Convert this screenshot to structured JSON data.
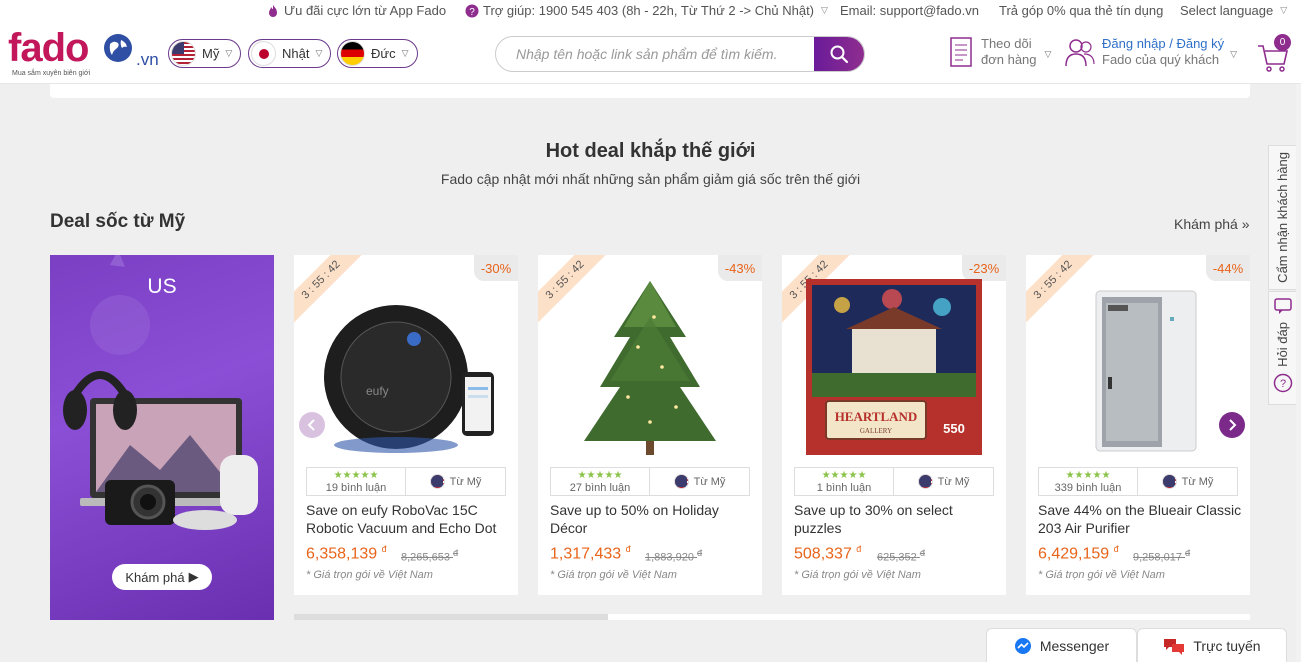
{
  "topbar": {
    "app_promo": "Ưu đãi cực lớn từ App Fado",
    "support": "Trợ giúp: 1900 545 403  (8h - 22h, Từ Thứ 2 -> Chủ Nhật)",
    "email": "Email: support@fado.vn",
    "installment": "Trả góp 0% qua thẻ tín dụng",
    "language": "Select language"
  },
  "header": {
    "logo_text": "fado",
    "logo_tld": ".vn",
    "logo_tagline": "Mua sắm xuyên biên giới",
    "countries": [
      "Mỹ",
      "Nhật",
      "Đức"
    ],
    "search_placeholder": "Nhập tên hoặc link sản phẩm để tìm kiếm.",
    "track_orders": [
      "Theo dõi",
      "đơn hàng"
    ],
    "login_register": "Đăng nhập / Đăng ký",
    "greeting": "Fado của quý khách",
    "cart_count": "0"
  },
  "section": {
    "title": "Hot deal khắp thế giới",
    "subtitle": "Fado cập nhật mới nhất những sản phẩm giảm giá sốc trên thế giới"
  },
  "deal_row": {
    "title": "Deal sốc từ Mỹ",
    "explore": "Khám phá »",
    "banner_label": "US",
    "banner_button": "Khám phá"
  },
  "products": [
    {
      "timer": "3 : 55 : 42",
      "discount": "-30%",
      "reviews": "19 bình luận",
      "origin": "Từ Mỹ",
      "name": "Save on eufy RoboVac 15C Robotic Vacuum and Echo Dot",
      "price": "6,358,139",
      "old_price": "8,265,653",
      "note": "* Giá trọn gói về Việt Nam"
    },
    {
      "timer": "3 : 55 : 42",
      "discount": "-43%",
      "reviews": "27 bình luận",
      "origin": "Từ Mỹ",
      "name": "Save up to 50% on Holiday Décor",
      "price": "1,317,433",
      "old_price": "1,883,920",
      "note": "* Giá trọn gói về Việt Nam"
    },
    {
      "timer": "3 : 55 : 42",
      "discount": "-23%",
      "reviews": "1 bình luận",
      "origin": "Từ Mỹ",
      "name": "Save up to 30% on select puzzles",
      "price": "508,337",
      "old_price": "625,352",
      "note": "* Giá trọn gói về Việt Nam"
    },
    {
      "timer": "3 : 55 : 42",
      "discount": "-44%",
      "reviews": "339 bình luận",
      "origin": "Từ Mỹ",
      "name": "Save 44% on the Blueair Classic 203 Air Purifier",
      "price": "6,429,159",
      "old_price": "9,258,017",
      "note": "* Giá trọn gói về Việt Nam"
    }
  ],
  "currency_symbol": "đ",
  "puzzle_brand": "HEARTLAND",
  "puzzle_sub": "GALLERY",
  "puzzle_count": "550",
  "side": {
    "care": "Cẩm nhận khách hàng",
    "faq": "Hỏi đáp"
  },
  "bottom": {
    "messenger": "Messenger",
    "online": "Trực tuyến"
  },
  "colors": {
    "brand": "#c2185b",
    "accent": "#7b2a8a",
    "price": "#e8641b",
    "link": "#2e6fc7"
  }
}
